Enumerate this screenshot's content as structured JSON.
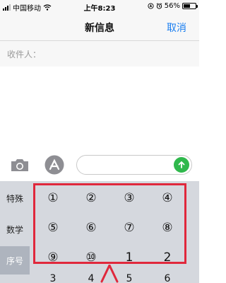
{
  "status_bar": {
    "carrier": "中国移动",
    "time": "上午8:23",
    "battery_percent": "56%",
    "battery_level": 0.56,
    "icons": [
      "signal-icon",
      "wifi-icon",
      "location-icon",
      "alarm-icon",
      "battery-icon"
    ]
  },
  "nav": {
    "title": "新信息",
    "cancel_label": "取消"
  },
  "recipient": {
    "label": "收件人："
  },
  "compose": {
    "icons": [
      "camera-icon",
      "appstore-icon",
      "send-arrow-icon"
    ],
    "send_color": "#2fb84c"
  },
  "keyboard": {
    "categories": [
      "特殊",
      "数学",
      "序号"
    ],
    "active_category": "序号",
    "keys": [
      "①",
      "②",
      "③",
      "④",
      "⑤",
      "⑥",
      "⑦",
      "⑧",
      "⑨",
      "⑩",
      "1",
      "2"
    ],
    "partial_row": [
      "3",
      "4",
      "5",
      "6"
    ]
  },
  "annotation": {
    "color": "#e0283c"
  }
}
